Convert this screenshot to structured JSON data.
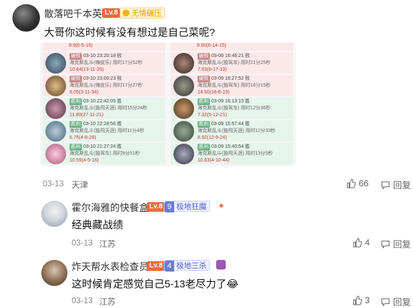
{
  "comment1": {
    "username": "散落吧千本英",
    "level": "Lv.8",
    "badge": "无情碾压",
    "text": "大哥你这时候有没有想过是自己菜呢?",
    "date": "03-13",
    "location": "天津",
    "likes": "66",
    "reply_label": "回复"
  },
  "screenshot": {
    "left_top": "9.9(6-5-16)",
    "right_top": "9.90(6-14-15)",
    "left": [
      {
        "result": "破败",
        "time": "03-10 23:20:18 败",
        "mode": "海克斯乱斗(嗨皮乐)",
        "dur": "用时17分52秒",
        "score": "10.84(13-11-20)"
      },
      {
        "result": "破败",
        "time": "03-10 23:00:23 败",
        "mode": "海克斯乱斗(嗨皮乐)",
        "dur": "用时17分27秒",
        "score": "8.05(3-11-34)"
      },
      {
        "result": "胜利",
        "time": "03-10 22:42:05 胜",
        "mode": "海克斯乱斗(独闯天涯)",
        "dur": "用时15分24秒",
        "score": "11.89(27-11-21)"
      },
      {
        "result": "胜利",
        "time": "03-10 22:28:56 胜",
        "mode": "海克斯乱斗(独闯天涯)",
        "dur": "用时11分4秒",
        "score": "6.75(4-8-28)"
      },
      {
        "result": "胜利",
        "time": "03-10 21:27:24 胜",
        "mode": "海克斯乱斗(独驾车)",
        "dur": "用时9分51秒",
        "score": "10.59(4-5-16)"
      }
    ],
    "right": [
      {
        "result": "破败",
        "time": "03-09 16:46:21 败",
        "mode": "海克斯乱斗(独驾车)",
        "dur": "用时21分25秒",
        "score": "7.63(8-17-19)"
      },
      {
        "result": "破败",
        "time": "03-09 16:27:52 败",
        "mode": "海克斯乱斗(独驾车)",
        "dur": "用时16分15秒",
        "score": "14.50(18-6-19)"
      },
      {
        "result": "胜利",
        "time": "03-09 16:13:15 胜",
        "mode": "海克斯乱斗(独驾车)",
        "dur": "用时12分36秒",
        "score": "7.32(5-12-21)"
      },
      {
        "result": "胜利",
        "time": "03-09 15:57:44 胜",
        "mode": "海克斯乱斗(独闯天涯)",
        "dur": "用时12分33秒",
        "score": "8.92(12-9-24)"
      },
      {
        "result": "胜利",
        "time": "03-09 15:40:54 胜",
        "mode": "海克斯乱斗(独闯天涯)",
        "dur": "用时13分5秒",
        "score": "10.63(4-10-44)"
      }
    ]
  },
  "comment2": {
    "username": "霍尔海雅的快餐盒",
    "level": "Lv.8",
    "fan_level": "9",
    "badge": "极地狂魔",
    "text": "经典藏战绩",
    "date": "03-13",
    "location": "江苏",
    "likes": "4",
    "reply_label": "回复"
  },
  "comment3": {
    "username": "炸天帮水表检查员",
    "level": "Lv.8",
    "fan_level": "4",
    "badge": "极地三杀",
    "text": "这时候肯定感觉自己5-13老尽力了😂",
    "date": "03-13",
    "location": "江苏",
    "likes": "3",
    "reply_label": "回复"
  },
  "colors": {
    "lv_badge": "#f06a3d",
    "lose_row": "#fbe9e9",
    "win_row": "#e6f5ec",
    "fan_badge": "#6d7bd8"
  }
}
